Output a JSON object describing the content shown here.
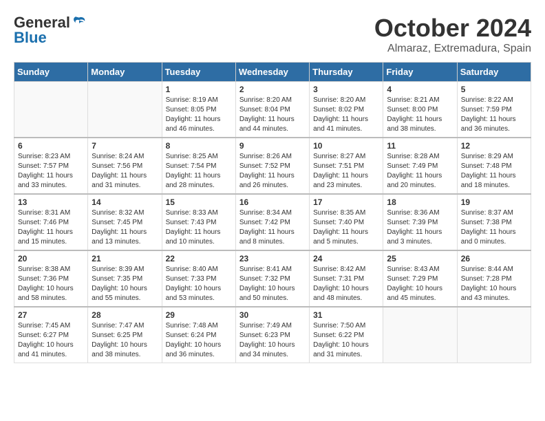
{
  "logo": {
    "general": "General",
    "blue": "Blue"
  },
  "title": {
    "month_year": "October 2024",
    "location": "Almaraz, Extremadura, Spain"
  },
  "headers": [
    "Sunday",
    "Monday",
    "Tuesday",
    "Wednesday",
    "Thursday",
    "Friday",
    "Saturday"
  ],
  "weeks": [
    [
      {
        "day": "",
        "info": ""
      },
      {
        "day": "",
        "info": ""
      },
      {
        "day": "1",
        "info": "Sunrise: 8:19 AM\nSunset: 8:05 PM\nDaylight: 11 hours and 46 minutes."
      },
      {
        "day": "2",
        "info": "Sunrise: 8:20 AM\nSunset: 8:04 PM\nDaylight: 11 hours and 44 minutes."
      },
      {
        "day": "3",
        "info": "Sunrise: 8:20 AM\nSunset: 8:02 PM\nDaylight: 11 hours and 41 minutes."
      },
      {
        "day": "4",
        "info": "Sunrise: 8:21 AM\nSunset: 8:00 PM\nDaylight: 11 hours and 38 minutes."
      },
      {
        "day": "5",
        "info": "Sunrise: 8:22 AM\nSunset: 7:59 PM\nDaylight: 11 hours and 36 minutes."
      }
    ],
    [
      {
        "day": "6",
        "info": "Sunrise: 8:23 AM\nSunset: 7:57 PM\nDaylight: 11 hours and 33 minutes."
      },
      {
        "day": "7",
        "info": "Sunrise: 8:24 AM\nSunset: 7:56 PM\nDaylight: 11 hours and 31 minutes."
      },
      {
        "day": "8",
        "info": "Sunrise: 8:25 AM\nSunset: 7:54 PM\nDaylight: 11 hours and 28 minutes."
      },
      {
        "day": "9",
        "info": "Sunrise: 8:26 AM\nSunset: 7:52 PM\nDaylight: 11 hours and 26 minutes."
      },
      {
        "day": "10",
        "info": "Sunrise: 8:27 AM\nSunset: 7:51 PM\nDaylight: 11 hours and 23 minutes."
      },
      {
        "day": "11",
        "info": "Sunrise: 8:28 AM\nSunset: 7:49 PM\nDaylight: 11 hours and 20 minutes."
      },
      {
        "day": "12",
        "info": "Sunrise: 8:29 AM\nSunset: 7:48 PM\nDaylight: 11 hours and 18 minutes."
      }
    ],
    [
      {
        "day": "13",
        "info": "Sunrise: 8:31 AM\nSunset: 7:46 PM\nDaylight: 11 hours and 15 minutes."
      },
      {
        "day": "14",
        "info": "Sunrise: 8:32 AM\nSunset: 7:45 PM\nDaylight: 11 hours and 13 minutes."
      },
      {
        "day": "15",
        "info": "Sunrise: 8:33 AM\nSunset: 7:43 PM\nDaylight: 11 hours and 10 minutes."
      },
      {
        "day": "16",
        "info": "Sunrise: 8:34 AM\nSunset: 7:42 PM\nDaylight: 11 hours and 8 minutes."
      },
      {
        "day": "17",
        "info": "Sunrise: 8:35 AM\nSunset: 7:40 PM\nDaylight: 11 hours and 5 minutes."
      },
      {
        "day": "18",
        "info": "Sunrise: 8:36 AM\nSunset: 7:39 PM\nDaylight: 11 hours and 3 minutes."
      },
      {
        "day": "19",
        "info": "Sunrise: 8:37 AM\nSunset: 7:38 PM\nDaylight: 11 hours and 0 minutes."
      }
    ],
    [
      {
        "day": "20",
        "info": "Sunrise: 8:38 AM\nSunset: 7:36 PM\nDaylight: 10 hours and 58 minutes."
      },
      {
        "day": "21",
        "info": "Sunrise: 8:39 AM\nSunset: 7:35 PM\nDaylight: 10 hours and 55 minutes."
      },
      {
        "day": "22",
        "info": "Sunrise: 8:40 AM\nSunset: 7:33 PM\nDaylight: 10 hours and 53 minutes."
      },
      {
        "day": "23",
        "info": "Sunrise: 8:41 AM\nSunset: 7:32 PM\nDaylight: 10 hours and 50 minutes."
      },
      {
        "day": "24",
        "info": "Sunrise: 8:42 AM\nSunset: 7:31 PM\nDaylight: 10 hours and 48 minutes."
      },
      {
        "day": "25",
        "info": "Sunrise: 8:43 AM\nSunset: 7:29 PM\nDaylight: 10 hours and 45 minutes."
      },
      {
        "day": "26",
        "info": "Sunrise: 8:44 AM\nSunset: 7:28 PM\nDaylight: 10 hours and 43 minutes."
      }
    ],
    [
      {
        "day": "27",
        "info": "Sunrise: 7:45 AM\nSunset: 6:27 PM\nDaylight: 10 hours and 41 minutes."
      },
      {
        "day": "28",
        "info": "Sunrise: 7:47 AM\nSunset: 6:25 PM\nDaylight: 10 hours and 38 minutes."
      },
      {
        "day": "29",
        "info": "Sunrise: 7:48 AM\nSunset: 6:24 PM\nDaylight: 10 hours and 36 minutes."
      },
      {
        "day": "30",
        "info": "Sunrise: 7:49 AM\nSunset: 6:23 PM\nDaylight: 10 hours and 34 minutes."
      },
      {
        "day": "31",
        "info": "Sunrise: 7:50 AM\nSunset: 6:22 PM\nDaylight: 10 hours and 31 minutes."
      },
      {
        "day": "",
        "info": ""
      },
      {
        "day": "",
        "info": ""
      }
    ]
  ]
}
